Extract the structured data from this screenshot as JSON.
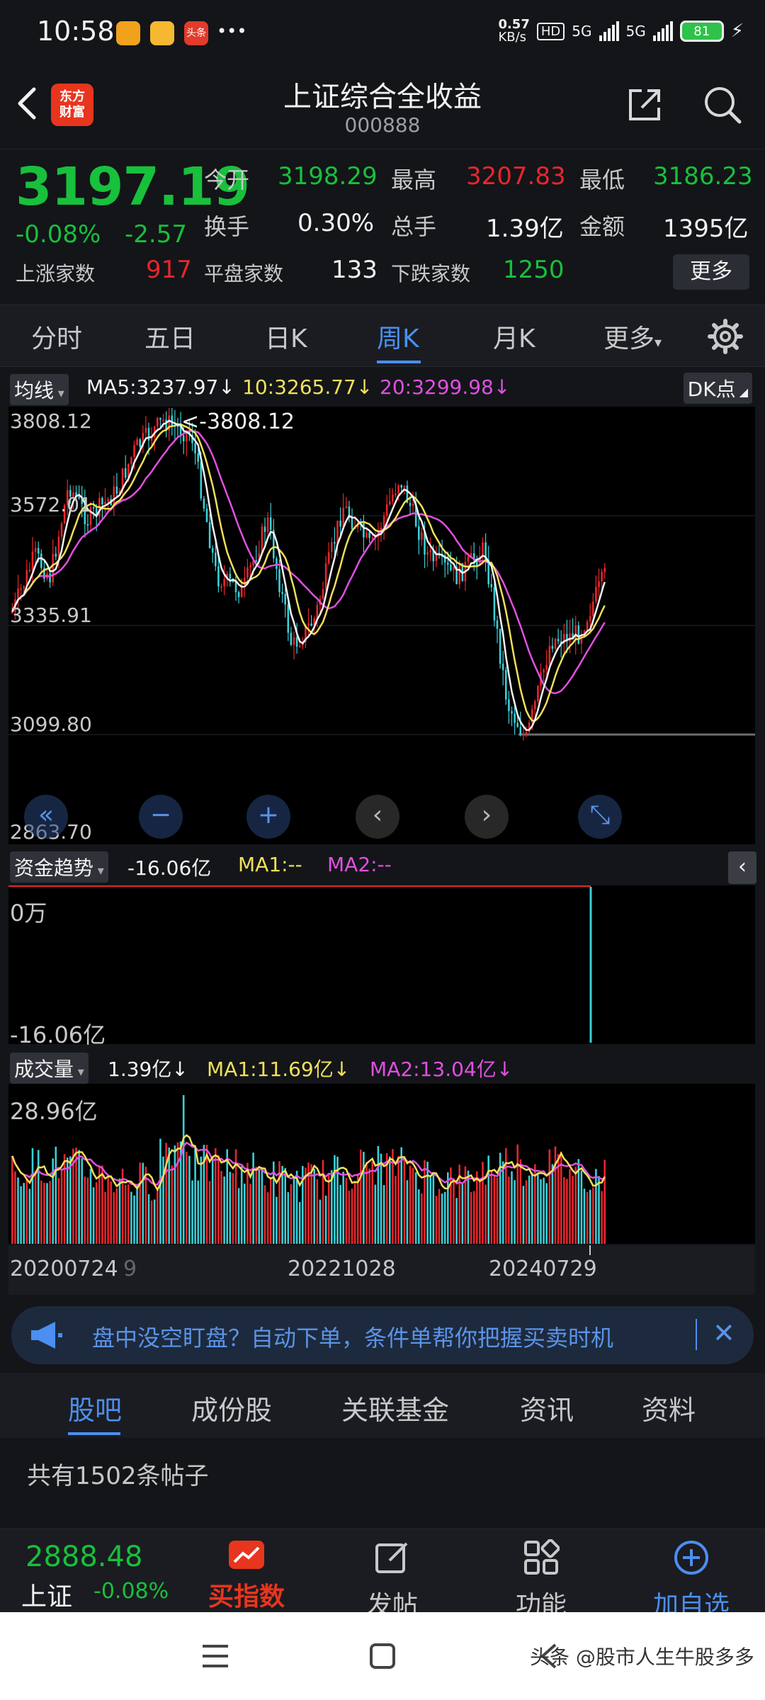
{
  "status": {
    "time": "10:58",
    "net_speed": "0.57",
    "net_unit": "KB/s",
    "hd": "HD",
    "sim1": "5G",
    "sim2": "5G",
    "battery": "81",
    "more": "•••",
    "app3_text": "头条"
  },
  "header": {
    "title": "上证综合全收益",
    "code": "000888",
    "logo_line1": "东方",
    "logo_line2": "财富"
  },
  "quote": {
    "price": "3197.19",
    "change_pct": "-0.08%",
    "change_abs": "-2.57",
    "open_label": "今开",
    "open": "3198.29",
    "high_label": "最高",
    "high": "3207.83",
    "low_label": "最低",
    "low": "3186.23",
    "turnover_label": "换手",
    "turnover": "0.30%",
    "volume_label": "总手",
    "volume": "1.39亿",
    "amount_label": "金额",
    "amount": "1395亿",
    "up_label": "上涨家数",
    "up": "917",
    "flat_label": "平盘家数",
    "flat": "133",
    "down_label": "下跌家数",
    "down": "1250",
    "more_label": "更多"
  },
  "period_tabs": [
    "分时",
    "五日",
    "日K",
    "周K",
    "月K",
    "更多"
  ],
  "period_active": "周K",
  "ma_legend": {
    "type": "均线",
    "ma5": "MA5:3237.97",
    "ma10": "10:3265.77",
    "ma20": "20:3299.98",
    "dk": "DK点"
  },
  "kline": {
    "y_labels": [
      "3808.12",
      "3572.01",
      "3335.91",
      "3099.80",
      "2863.70"
    ],
    "high_marker": "<-3808.12",
    "controls": [
      "«",
      "−",
      "+",
      "‹",
      "›",
      "⤡"
    ]
  },
  "fund": {
    "label": "资金趋势",
    "value": "-16.06亿",
    "ma1": "MA1:--",
    "ma2": "MA2:--",
    "y_top": "0万",
    "y_bottom": "-16.06亿",
    "collapse": "‹"
  },
  "volume": {
    "label": "成交量",
    "value": "1.39亿",
    "ma1": "MA1:11.69亿",
    "ma2": "MA2:13.04亿",
    "y_top": "28.96亿",
    "dates": [
      "20200724",
      "20221028",
      "20240729"
    ],
    "date_suffix": "9"
  },
  "banner": {
    "text": "盘中没空盯盘？自动下单，条件单帮你把握买卖时机",
    "close": "✕"
  },
  "content_tabs": [
    "股吧",
    "成份股",
    "关联基金",
    "资讯",
    "资料"
  ],
  "content_active": "股吧",
  "posts": {
    "count_text": "共有1502条帖子"
  },
  "toolbar": {
    "mini_price": "2888.48",
    "mini_name": "上证",
    "mini_pct": "-0.08%",
    "buy_index": "买指数",
    "post": "发帖",
    "functions": "功能",
    "add_watch": "加自选"
  },
  "watermark": "头条 @股市人生牛股多多",
  "colors": {
    "up": "#e8262c",
    "down": "#18c03c",
    "accent": "#4b8ff0",
    "candle_down": "#39d0d8",
    "ma5": "#f2f2f2",
    "ma10": "#f0e05a",
    "ma20": "#e050e0"
  }
}
